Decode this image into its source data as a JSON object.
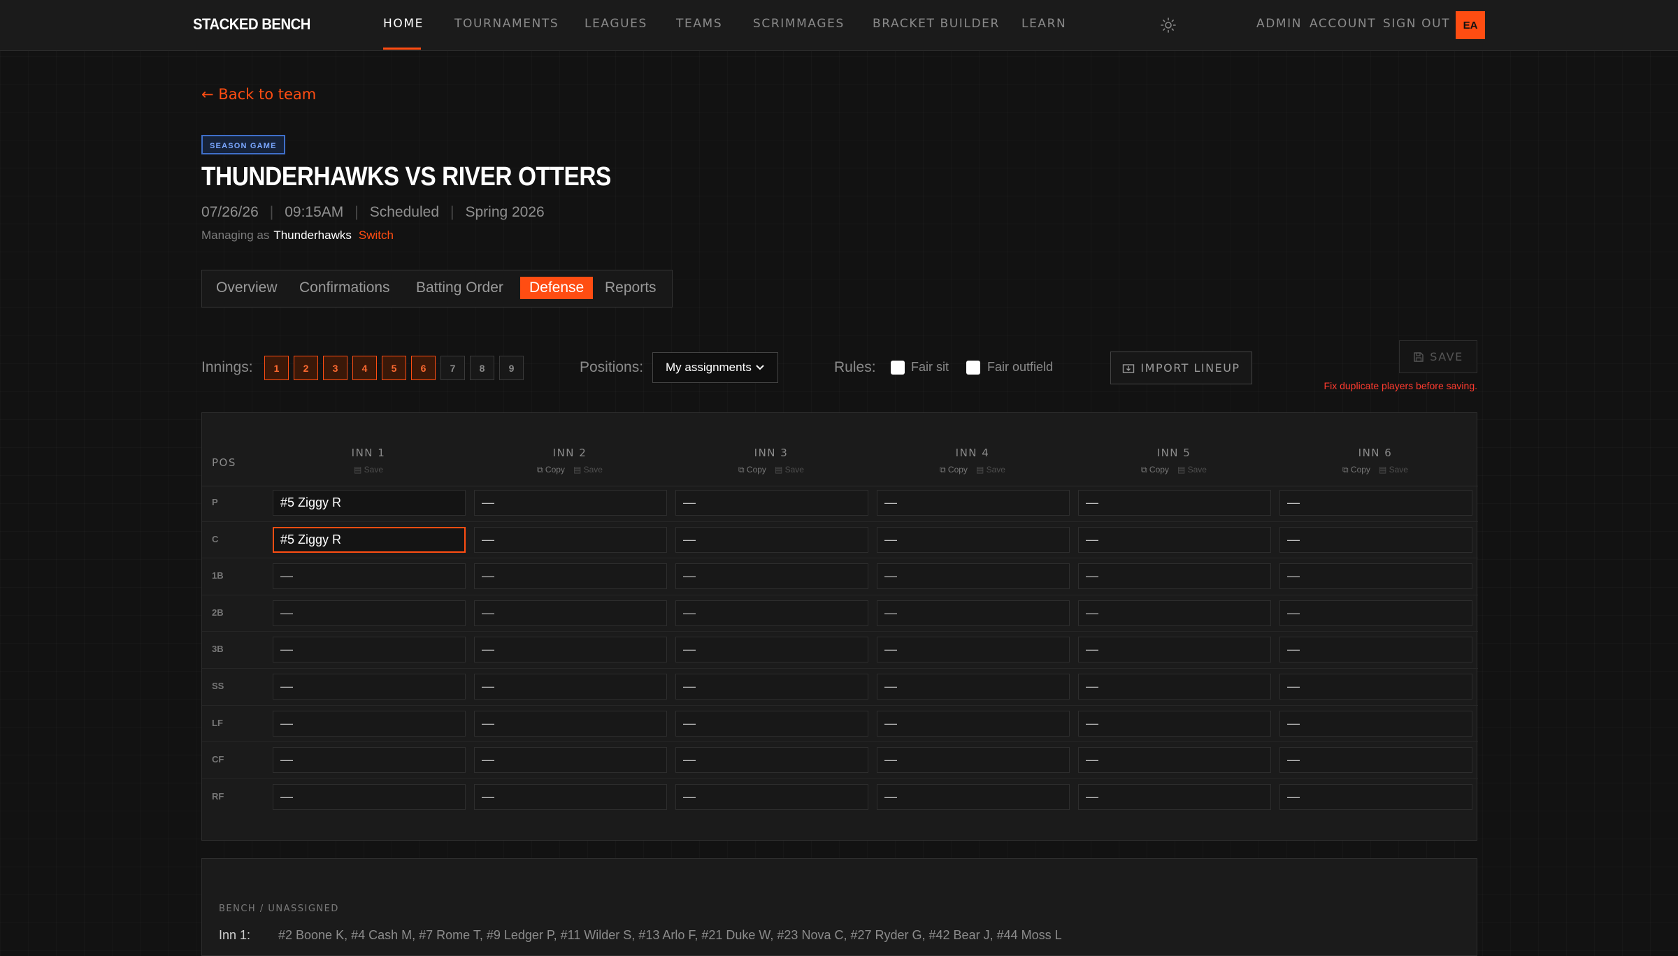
{
  "nav": {
    "brand": "STACKED BENCH",
    "links": [
      "HOME",
      "TOURNAMENTS",
      "LEAGUES",
      "TEAMS",
      "SCRIMMAGES",
      "BRACKET BUILDER",
      "LEARN"
    ],
    "active": "HOME",
    "right_links": [
      "ADMIN",
      "ACCOUNT",
      "SIGN OUT"
    ],
    "avatar_initials": "EA"
  },
  "back_link": "Back to team",
  "game": {
    "badge": "SEASON GAME",
    "title": "THUNDERHAWKS VS RIVER OTTERS",
    "date": "07/26/26",
    "time": "09:15AM",
    "status": "Scheduled",
    "season": "Spring 2026",
    "managing_prefix": "Managing as",
    "managing_team": "Thunderhawks",
    "switch_label": "Switch"
  },
  "tabs": [
    "Overview",
    "Confirmations",
    "Batting Order",
    "Defense",
    "Reports"
  ],
  "active_tab": "Defense",
  "controls": {
    "innings_label": "Innings:",
    "innings": [
      {
        "label": "1",
        "selected": true
      },
      {
        "label": "2",
        "selected": true
      },
      {
        "label": "3",
        "selected": true
      },
      {
        "label": "4",
        "selected": true
      },
      {
        "label": "5",
        "selected": true
      },
      {
        "label": "6",
        "selected": true
      },
      {
        "label": "7",
        "selected": false
      },
      {
        "label": "8",
        "selected": false
      },
      {
        "label": "9",
        "selected": false
      }
    ],
    "positions_label": "Positions:",
    "positions_value": "My assignments",
    "rules_label": "Rules:",
    "fair_sit": "Fair sit",
    "fair_outfield": "Fair outfield",
    "import_label": "IMPORT LINEUP",
    "save_label": "SAVE",
    "error_message": "Fix duplicate players before saving."
  },
  "grid": {
    "pos_header": "POS",
    "copy_label": "Copy",
    "save_label": "Save",
    "innings": [
      "INN 1",
      "INN 2",
      "INN 3",
      "INN 4",
      "INN 5",
      "INN 6"
    ],
    "positions": [
      "P",
      "C",
      "1B",
      "2B",
      "3B",
      "SS",
      "LF",
      "CF",
      "RF"
    ],
    "empty_value": "—",
    "assignments": {
      "P": [
        "#5 Ziggy R",
        "—",
        "—",
        "—",
        "—",
        "—"
      ],
      "C": [
        "#5 Ziggy R",
        "—",
        "—",
        "—",
        "—",
        "—"
      ],
      "1B": [
        "—",
        "—",
        "—",
        "—",
        "—",
        "—"
      ],
      "2B": [
        "—",
        "—",
        "—",
        "—",
        "—",
        "—"
      ],
      "3B": [
        "—",
        "—",
        "—",
        "—",
        "—",
        "—"
      ],
      "SS": [
        "—",
        "—",
        "—",
        "—",
        "—",
        "—"
      ],
      "LF": [
        "—",
        "—",
        "—",
        "—",
        "—",
        "—"
      ],
      "CF": [
        "—",
        "—",
        "—",
        "—",
        "—",
        "—"
      ],
      "RF": [
        "—",
        "—",
        "—",
        "—",
        "—",
        "—"
      ]
    }
  },
  "bench": {
    "title": "BENCH / UNASSIGNED",
    "inning_label": "Inn 1:",
    "players": "#2 Boone K, #4 Cash M, #7 Rome T, #9 Ledger P, #11 Wilder S, #13 Arlo F, #21 Duke W, #23 Nova C, #27 Ryder G, #42 Bear J, #44 Moss L"
  },
  "colors": {
    "accent": "#ff4d12",
    "error": "#ff3b2f",
    "badge_blue": "#7aa7ff"
  }
}
